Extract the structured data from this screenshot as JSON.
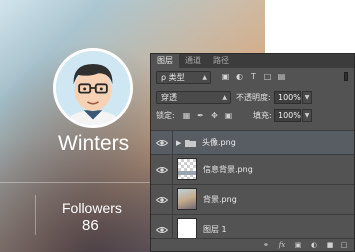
{
  "profile": {
    "username": "Winters",
    "followers_label": "Followers",
    "followers_count": "86"
  },
  "layers_panel": {
    "tabs": [
      {
        "label": "图层",
        "active": true
      },
      {
        "label": "通道",
        "active": false
      },
      {
        "label": "路径",
        "active": false
      }
    ],
    "filter": {
      "label": "ρ 类型"
    },
    "blend_mode": "穿透",
    "opacity_label": "不透明度:",
    "opacity_value": "100%",
    "lock_label": "锁定:",
    "fill_label": "填充:",
    "fill_value": "100%",
    "layers": [
      {
        "name": "头像.png",
        "type": "group",
        "selected": true
      },
      {
        "name": "信息背景.png",
        "type": "image"
      },
      {
        "name": "背景.png",
        "type": "image"
      },
      {
        "name": "图层 1",
        "type": "fill"
      }
    ]
  },
  "colors": {
    "panel_bg": "#535353",
    "tab_bar": "#3c3c3c",
    "selected_layer": "#585c63"
  }
}
